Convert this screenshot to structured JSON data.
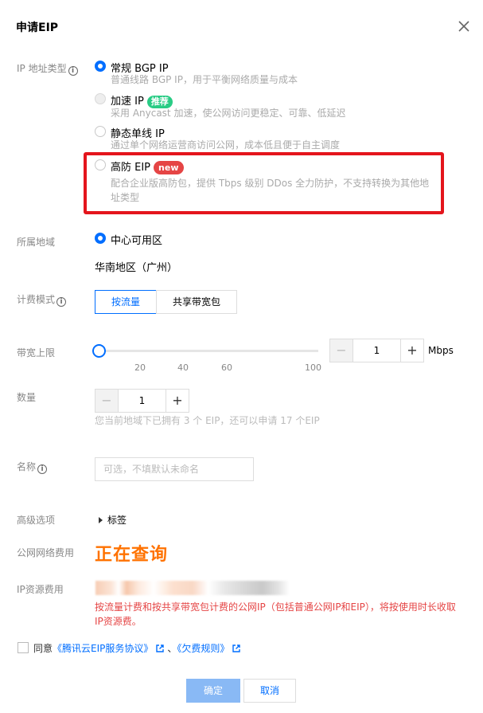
{
  "dialog": {
    "title": "申请EIP"
  },
  "ip_type": {
    "label": "IP 地址类型",
    "options": [
      {
        "name": "常规 BGP IP",
        "desc": "普通线路 BGP IP，用于平衡网络质量与成本",
        "tag": ""
      },
      {
        "name": "加速 IP",
        "desc": "采用 Anycast 加速，使公网访问更稳定、可靠、低延迟",
        "tag": "推荐"
      },
      {
        "name": "静态单线 IP",
        "desc": "通过单个网络运营商访问公网，成本低且便于自主调度",
        "tag": ""
      },
      {
        "name": "高防 EIP",
        "desc": "配合企业版高防包，提供 Tbps 级别 DDos 全力防护，不支持转换为其他地址类型",
        "tag": "new"
      }
    ]
  },
  "region": {
    "label": "所属地域",
    "option": "中心可用区",
    "value": "华南地区（广州）"
  },
  "billing": {
    "label": "计费模式",
    "options": [
      "按流量",
      "共享带宽包"
    ]
  },
  "bandwidth": {
    "label": "带宽上限",
    "ticks": [
      "20",
      "40",
      "60",
      "100"
    ],
    "value": "1",
    "unit": "Mbps"
  },
  "quantity": {
    "label": "数量",
    "value": "1",
    "hint": "您当前地域下已拥有 3 个 EIP，还可以申请 17 个EIP"
  },
  "name": {
    "label": "名称",
    "placeholder": "可选，不填默认未命名"
  },
  "advanced": {
    "label": "高级选项",
    "toggle": "标签"
  },
  "network_fee": {
    "label": "公网网络费用",
    "value": "正在查询"
  },
  "ip_fee": {
    "label": "IP资源费用",
    "warning": "按流量计费和按共享带宽包计费的公网IP（包括普通公网IP和EIP），将按使用时长收取IP资源费。"
  },
  "agreement": {
    "prefix": "同意",
    "link1": "《腾讯云EIP服务协议》",
    "sep": "、",
    "link2": "《欠费规则》"
  },
  "footer": {
    "confirm": "确定",
    "cancel": "取消"
  },
  "colors": {
    "accent": "#006eff",
    "warning": "#e54545",
    "price": "#ff7200",
    "highlight": "#e4151c"
  }
}
